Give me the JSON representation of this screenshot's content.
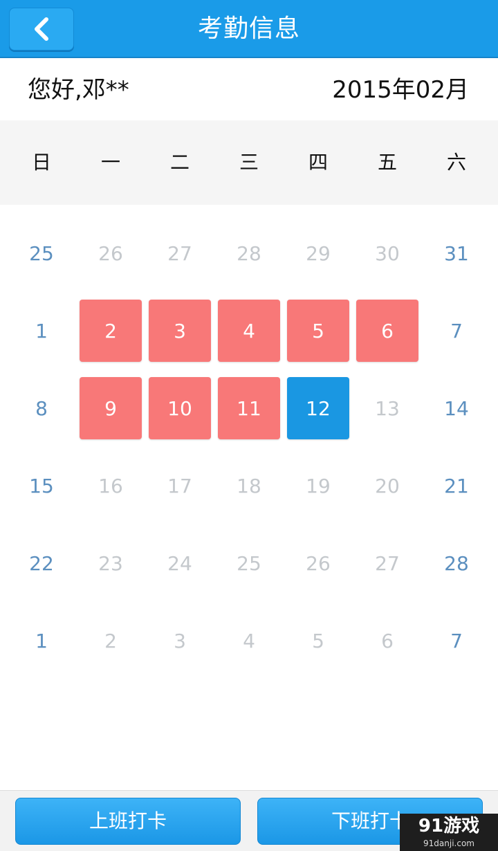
{
  "header": {
    "title": "考勤信息",
    "back_icon": "chevron-left-icon"
  },
  "greeting": "您好,邓**",
  "month_label": "2015年02月",
  "weekdays": [
    "日",
    "一",
    "二",
    "三",
    "四",
    "五",
    "六"
  ],
  "calendar": [
    [
      {
        "day": "25",
        "state": "weekend"
      },
      {
        "day": "26",
        "state": "other"
      },
      {
        "day": "27",
        "state": "other"
      },
      {
        "day": "28",
        "state": "other"
      },
      {
        "day": "29",
        "state": "other"
      },
      {
        "day": "30",
        "state": "other"
      },
      {
        "day": "31",
        "state": "weekend"
      }
    ],
    [
      {
        "day": "1",
        "state": "weekend"
      },
      {
        "day": "2",
        "state": "absent"
      },
      {
        "day": "3",
        "state": "absent"
      },
      {
        "day": "4",
        "state": "absent"
      },
      {
        "day": "5",
        "state": "absent"
      },
      {
        "day": "6",
        "state": "absent"
      },
      {
        "day": "7",
        "state": "weekend"
      }
    ],
    [
      {
        "day": "8",
        "state": "weekend"
      },
      {
        "day": "9",
        "state": "absent"
      },
      {
        "day": "10",
        "state": "absent"
      },
      {
        "day": "11",
        "state": "absent"
      },
      {
        "day": "12",
        "state": "today"
      },
      {
        "day": "13",
        "state": "workday"
      },
      {
        "day": "14",
        "state": "weekend"
      }
    ],
    [
      {
        "day": "15",
        "state": "weekend"
      },
      {
        "day": "16",
        "state": "workday"
      },
      {
        "day": "17",
        "state": "workday"
      },
      {
        "day": "18",
        "state": "workday"
      },
      {
        "day": "19",
        "state": "workday"
      },
      {
        "day": "20",
        "state": "workday"
      },
      {
        "day": "21",
        "state": "weekend"
      }
    ],
    [
      {
        "day": "22",
        "state": "weekend"
      },
      {
        "day": "23",
        "state": "workday"
      },
      {
        "day": "24",
        "state": "workday"
      },
      {
        "day": "25",
        "state": "workday"
      },
      {
        "day": "26",
        "state": "workday"
      },
      {
        "day": "27",
        "state": "workday"
      },
      {
        "day": "28",
        "state": "weekend"
      }
    ],
    [
      {
        "day": "1",
        "state": "weekend"
      },
      {
        "day": "2",
        "state": "other"
      },
      {
        "day": "3",
        "state": "other"
      },
      {
        "day": "4",
        "state": "other"
      },
      {
        "day": "5",
        "state": "other"
      },
      {
        "day": "6",
        "state": "other"
      },
      {
        "day": "7",
        "state": "weekend"
      }
    ]
  ],
  "buttons": {
    "clock_in": "上班打卡",
    "clock_out": "下班打卡"
  },
  "watermark": {
    "logo": "91游戏",
    "url": "91danji.com"
  },
  "colors": {
    "primary": "#1a9be8",
    "absent": "#f87878",
    "today": "#1a97e2",
    "weekend_text": "#5b8fbf",
    "muted_text": "#c4c8cc"
  }
}
